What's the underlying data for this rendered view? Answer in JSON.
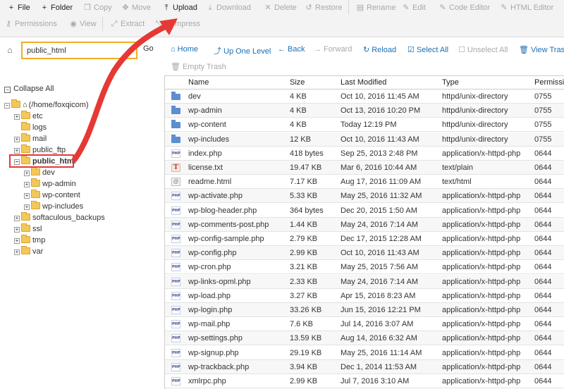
{
  "toolbar": {
    "items": [
      {
        "label": "File",
        "icon": "plus-icon",
        "glyph": "+",
        "active": true
      },
      {
        "label": "Folder",
        "icon": "plus-icon",
        "glyph": "+",
        "active": true
      },
      {
        "label": "Copy",
        "icon": "copy-icon",
        "glyph": "❐",
        "active": false
      },
      {
        "label": "Move",
        "icon": "move-icon",
        "glyph": "✥",
        "active": false
      },
      {
        "label": "Upload",
        "icon": "upload-icon",
        "glyph": "⤒",
        "active": true
      },
      {
        "label": "Download",
        "icon": "download-icon",
        "glyph": "⤓",
        "active": false
      },
      {
        "label": "Delete",
        "icon": "delete-icon",
        "glyph": "✕",
        "active": false
      },
      {
        "label": "Restore",
        "icon": "restore-icon",
        "glyph": "↺",
        "active": false
      },
      {
        "label": "Rename",
        "icon": "rename-icon",
        "glyph": "▤",
        "active": false
      },
      {
        "label": "Edit",
        "icon": "edit-icon",
        "glyph": "✎",
        "active": false
      },
      {
        "label": "Code Editor",
        "icon": "code-editor-icon",
        "glyph": "✎",
        "active": false
      },
      {
        "label": "HTML Editor",
        "icon": "html-editor-icon",
        "glyph": "✎",
        "active": false
      },
      {
        "label": "Permissions",
        "icon": "key-icon",
        "glyph": "⚷",
        "active": false
      },
      {
        "label": "View",
        "icon": "eye-icon",
        "glyph": "◉",
        "active": false
      },
      {
        "label": "Extract",
        "icon": "extract-icon",
        "glyph": "⤢",
        "active": false
      },
      {
        "label": "Compress",
        "icon": "compress-icon",
        "glyph": "⤡",
        "active": false
      }
    ]
  },
  "path": {
    "value": "public_html",
    "go_label": "Go"
  },
  "actions": {
    "home": "Home",
    "up": "Up One Level",
    "back": "Back",
    "forward": "Forward",
    "reload": "Reload",
    "select_all": "Select All",
    "unselect_all": "Unselect All",
    "view_trash": "View Trash",
    "empty_trash": "Empty Trash"
  },
  "tree": {
    "collapse_all": "Collapse All",
    "root": "(/home/foxqicom)",
    "items": [
      "etc",
      "logs",
      "mail",
      "public_ftp",
      "public_html",
      "dev",
      "wp-admin",
      "wp-content",
      "wp-includes",
      "softaculous_backups",
      "ssl",
      "tmp",
      "var"
    ]
  },
  "table": {
    "headers": {
      "name": "Name",
      "size": "Size",
      "modified": "Last Modified",
      "type": "Type",
      "perms": "Permissions"
    },
    "rows": [
      {
        "kind": "dir",
        "name": "dev",
        "size": "4 KB",
        "modified": "Oct 10, 2016 11:45 AM",
        "type": "httpd/unix-directory",
        "perms": "0755"
      },
      {
        "kind": "dir",
        "name": "wp-admin",
        "size": "4 KB",
        "modified": "Oct 13, 2016 10:20 PM",
        "type": "httpd/unix-directory",
        "perms": "0755"
      },
      {
        "kind": "dir",
        "name": "wp-content",
        "size": "4 KB",
        "modified": "Today 12:19 PM",
        "type": "httpd/unix-directory",
        "perms": "0755"
      },
      {
        "kind": "dir",
        "name": "wp-includes",
        "size": "12 KB",
        "modified": "Oct 10, 2016 11:43 AM",
        "type": "httpd/unix-directory",
        "perms": "0755"
      },
      {
        "kind": "php",
        "name": "index.php",
        "size": "418 bytes",
        "modified": "Sep 25, 2013 2:48 PM",
        "type": "application/x-httpd-php",
        "perms": "0644"
      },
      {
        "kind": "txt",
        "name": "license.txt",
        "size": "19.47 KB",
        "modified": "Mar 6, 2016 10:44 AM",
        "type": "text/plain",
        "perms": "0644"
      },
      {
        "kind": "html",
        "name": "readme.html",
        "size": "7.17 KB",
        "modified": "Aug 17, 2016 11:09 AM",
        "type": "text/html",
        "perms": "0644"
      },
      {
        "kind": "php",
        "name": "wp-activate.php",
        "size": "5.33 KB",
        "modified": "May 25, 2016 11:32 AM",
        "type": "application/x-httpd-php",
        "perms": "0644"
      },
      {
        "kind": "php",
        "name": "wp-blog-header.php",
        "size": "364 bytes",
        "modified": "Dec 20, 2015 1:50 AM",
        "type": "application/x-httpd-php",
        "perms": "0644"
      },
      {
        "kind": "php",
        "name": "wp-comments-post.php",
        "size": "1.44 KB",
        "modified": "May 24, 2016 7:14 AM",
        "type": "application/x-httpd-php",
        "perms": "0644"
      },
      {
        "kind": "php",
        "name": "wp-config-sample.php",
        "size": "2.79 KB",
        "modified": "Dec 17, 2015 12:28 AM",
        "type": "application/x-httpd-php",
        "perms": "0644"
      },
      {
        "kind": "php",
        "name": "wp-config.php",
        "size": "2.99 KB",
        "modified": "Oct 10, 2016 11:43 AM",
        "type": "application/x-httpd-php",
        "perms": "0644"
      },
      {
        "kind": "php",
        "name": "wp-cron.php",
        "size": "3.21 KB",
        "modified": "May 25, 2015 7:56 AM",
        "type": "application/x-httpd-php",
        "perms": "0644"
      },
      {
        "kind": "php",
        "name": "wp-links-opml.php",
        "size": "2.33 KB",
        "modified": "May 24, 2016 7:14 AM",
        "type": "application/x-httpd-php",
        "perms": "0644"
      },
      {
        "kind": "php",
        "name": "wp-load.php",
        "size": "3.27 KB",
        "modified": "Apr 15, 2016 8:23 AM",
        "type": "application/x-httpd-php",
        "perms": "0644"
      },
      {
        "kind": "php",
        "name": "wp-login.php",
        "size": "33.26 KB",
        "modified": "Jun 15, 2016 12:21 PM",
        "type": "application/x-httpd-php",
        "perms": "0644"
      },
      {
        "kind": "php",
        "name": "wp-mail.php",
        "size": "7.6 KB",
        "modified": "Jul 14, 2016 3:07 AM",
        "type": "application/x-httpd-php",
        "perms": "0644"
      },
      {
        "kind": "php",
        "name": "wp-settings.php",
        "size": "13.59 KB",
        "modified": "Aug 14, 2016 6:32 AM",
        "type": "application/x-httpd-php",
        "perms": "0644"
      },
      {
        "kind": "php",
        "name": "wp-signup.php",
        "size": "29.19 KB",
        "modified": "May 25, 2016 11:14 AM",
        "type": "application/x-httpd-php",
        "perms": "0644"
      },
      {
        "kind": "php",
        "name": "wp-trackback.php",
        "size": "3.94 KB",
        "modified": "Dec 1, 2014 11:53 AM",
        "type": "application/x-httpd-php",
        "perms": "0644"
      },
      {
        "kind": "php",
        "name": "xmlrpc.php",
        "size": "2.99 KB",
        "modified": "Jul 7, 2016 3:10 AM",
        "type": "application/x-httpd-php",
        "perms": "0644"
      }
    ]
  },
  "colors": {
    "accent": "#1a6fb5",
    "highlight_input": "#f0ad2b",
    "annotation": "#e53935"
  }
}
